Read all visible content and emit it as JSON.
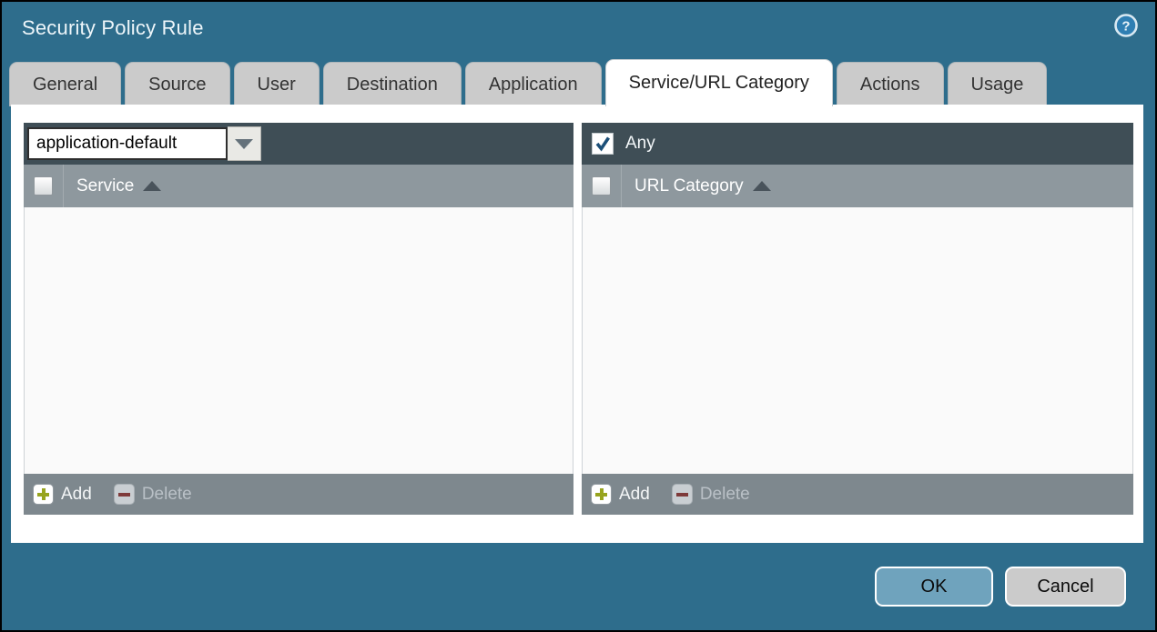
{
  "window": {
    "title": "Security Policy Rule"
  },
  "icons": {
    "help": "?",
    "dropdown": "tri-down",
    "sort_asc": "tri-up",
    "add": "plus",
    "delete": "minus",
    "check": "check"
  },
  "colors": {
    "titlebar_teal": "#2e6d8c",
    "tab_gray": "#cbcbcb",
    "active_tab_white": "#ffffff",
    "panel_toolbar_dark": "#3f4e56",
    "header_gray": "#8e989e",
    "footer_gray": "#7e888e",
    "ok_button_blue": "#6fa3bd",
    "cancel_button_gray": "#cbcbcb",
    "add_icon_green": "#97a41f",
    "delete_icon_red": "#7e3a3a",
    "check_blue": "#1c4f78"
  },
  "tabs": [
    {
      "label": "General",
      "active": false
    },
    {
      "label": "Source",
      "active": false
    },
    {
      "label": "User",
      "active": false
    },
    {
      "label": "Destination",
      "active": false
    },
    {
      "label": "Application",
      "active": false
    },
    {
      "label": "Service/URL Category",
      "active": true
    },
    {
      "label": "Actions",
      "active": false
    },
    {
      "label": "Usage",
      "active": false
    }
  ],
  "service_panel": {
    "dropdown_value": "application-default",
    "column_header": "Service",
    "header_checkbox_checked": false,
    "rows": [],
    "add_label": "Add",
    "delete_label": "Delete",
    "delete_enabled": false
  },
  "url_category_panel": {
    "any_label": "Any",
    "any_checked": true,
    "column_header": "URL Category",
    "header_checkbox_checked": false,
    "rows": [],
    "add_label": "Add",
    "delete_label": "Delete",
    "delete_enabled": false
  },
  "footer_buttons": {
    "ok": "OK",
    "cancel": "Cancel"
  }
}
